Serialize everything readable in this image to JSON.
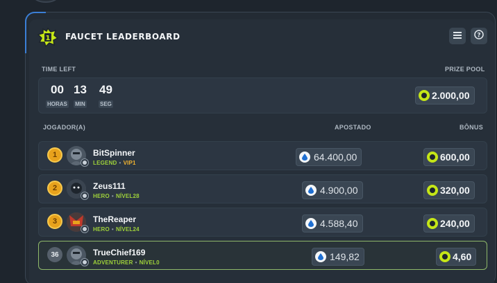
{
  "leaderboard": {
    "title": "FAUCET LEADERBOARD",
    "time_left_label": "TIME LEFT",
    "prize_pool_label": "PRIZE POOL",
    "timer": {
      "hours": "00",
      "hours_label": "HORAS",
      "minutes": "13",
      "minutes_label": "MIN",
      "seconds": "49",
      "seconds_label": "SEG"
    },
    "prize_pool": "2.000,00",
    "columns": {
      "player": "JOGADOR(A)",
      "staked": "APOSTADO",
      "bonus": "BÔNUS"
    },
    "rows": [
      {
        "rank": "1",
        "name": "BitSpinner",
        "tier": "LEGEND",
        "level": "VIP1",
        "staked": "64.400,00",
        "bonus": "600,00"
      },
      {
        "rank": "2",
        "name": "Zeus111",
        "tier": "HERO",
        "level": "NÍVEL28",
        "staked": "4.900,00",
        "bonus": "320,00"
      },
      {
        "rank": "3",
        "name": "TheReaper",
        "tier": "HERO",
        "level": "NÍVEL24",
        "staked": "4.588,40",
        "bonus": "240,00"
      },
      {
        "rank": "36",
        "name": "TrueChief169",
        "tier": "ADVENTURER",
        "level": "NÍVEL0",
        "staked": "149,82",
        "bonus": "4,60"
      }
    ]
  },
  "icons": {
    "header": "trophy-1-icon",
    "list": "list-icon",
    "help": "question-icon",
    "coin": "coin-icon",
    "stake": "drop-icon"
  },
  "colors": {
    "accent": "#c5e617",
    "gold": "#e8a21c",
    "highlight_border": "#8fb96a",
    "tier_green": "#9fd23a",
    "vip_gold": "#f2b430"
  }
}
